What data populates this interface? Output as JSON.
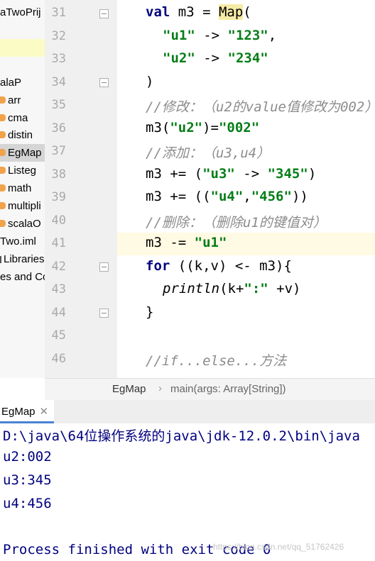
{
  "project": {
    "items": [
      {
        "label": "aTwoPrij",
        "icon": "none"
      },
      {
        "label": "",
        "icon": "none"
      },
      {
        "label": "",
        "icon": "none"
      },
      {
        "label": "",
        "icon": "none"
      },
      {
        "label": "alaP",
        "icon": "none"
      },
      {
        "label": "arr",
        "icon": "folder-icon"
      },
      {
        "label": "cma",
        "icon": "folder-icon"
      },
      {
        "label": "distin",
        "icon": "folder-icon"
      },
      {
        "label": "EgMap",
        "icon": "folder-icon"
      },
      {
        "label": "Listeg",
        "icon": "folder-icon"
      },
      {
        "label": "math",
        "icon": "folder-icon"
      },
      {
        "label": "multipli",
        "icon": "folder-icon"
      },
      {
        "label": "scalaO",
        "icon": "folder-icon"
      },
      {
        "label": "Two.iml",
        "icon": "none"
      },
      {
        "label": "Libraries",
        "icon": "library-icon"
      },
      {
        "label": "es and Co",
        "icon": "none"
      }
    ]
  },
  "editor": {
    "line_numbers": [
      "31",
      "32",
      "33",
      "34",
      "35",
      "36",
      "37",
      "38",
      "39",
      "40",
      "41",
      "42",
      "43",
      "44",
      "45",
      "46"
    ],
    "current_line": "41"
  },
  "breadcrumb": {
    "object": "EgMap",
    "separator": "›",
    "method": "main(args: Array[String])"
  },
  "run": {
    "tab_label": "EgMap",
    "close_glyph": "✕",
    "output": [
      "D:\\java\\64位操作系统的java\\jdk-12.0.2\\bin\\java",
      "u2:002",
      "u3:345",
      "u4:456",
      "",
      "Process finished with exit code 0"
    ]
  },
  "watermark": "https://blog.csdn.net/qq_51762426",
  "colors": {
    "keyword": "#000080",
    "string": "#067d17",
    "comment": "#8c8c8c",
    "console_text": "#000080"
  }
}
